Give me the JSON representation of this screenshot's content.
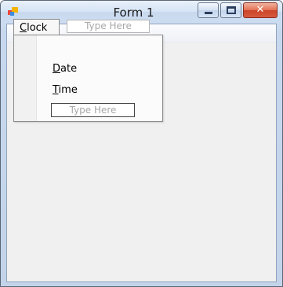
{
  "window": {
    "title": "Form 1",
    "icon": "form-app-icon",
    "controls": {
      "minimize": "minimize-icon",
      "maximize": "maximize-icon",
      "close_label": "✕"
    }
  },
  "menu": {
    "items": [
      {
        "label": "Clock",
        "accel": "C",
        "rest": "lock"
      }
    ],
    "type_here": "Type Here"
  },
  "dropdown": {
    "items": [
      {
        "label": "Date",
        "accel": "D",
        "rest": "ate"
      },
      {
        "label": "Time",
        "accel": "T",
        "rest": "ime"
      }
    ],
    "type_here": "Type Here"
  },
  "colors": {
    "titlebar": "#d6e4f5",
    "client_bg": "#f0f0f0",
    "close_button": "#d85a3e",
    "placeholder_text": "#a8a8a8"
  }
}
